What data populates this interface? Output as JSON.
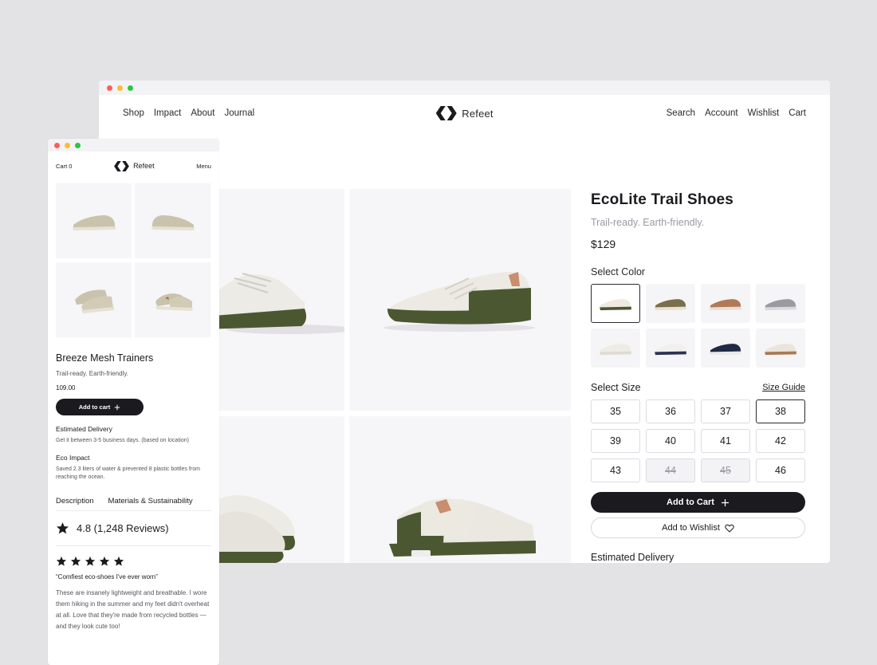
{
  "colors": {
    "red": "#ff5f57",
    "yellow": "#febc2e",
    "green": "#28c840",
    "olive": "#4b5731",
    "primary": "#1b1b1f",
    "muted": "#9a99a3"
  },
  "desktop": {
    "nav_left": [
      "Shop",
      "Impact",
      "About",
      "Journal"
    ],
    "brand": "Refeet",
    "nav_right": [
      "Search",
      "Account",
      "Wishlist",
      "Cart"
    ],
    "product": {
      "title": "EcoLite Trail Shoes",
      "subtitle": "Trail-ready. Earth-friendly.",
      "price": "$129",
      "select_color_label": "Select Color",
      "colors": [
        {
          "upper": "#eeeae2",
          "sole": "#4b5731"
        },
        {
          "upper": "#7a6f4b",
          "sole": "#e8e1d4"
        },
        {
          "upper": "#b07a58",
          "sole": "#e8dfd4"
        },
        {
          "upper": "#9a9ba0",
          "sole": "#dadadd"
        },
        {
          "upper": "#efece6",
          "sole": "#e0dbd2"
        },
        {
          "upper": "#f1f0ee",
          "sole": "#2c3450"
        },
        {
          "upper": "#1f2a44",
          "sole": "#e9e9e9"
        },
        {
          "upper": "#ebe4da",
          "sole": "#a97a52"
        }
      ],
      "select_size_label": "Select Size",
      "size_guide": "Size Guide",
      "sizes": [
        {
          "label": "35",
          "state": "available"
        },
        {
          "label": "36",
          "state": "available"
        },
        {
          "label": "37",
          "state": "available"
        },
        {
          "label": "38",
          "state": "selected"
        },
        {
          "label": "39",
          "state": "available"
        },
        {
          "label": "40",
          "state": "available"
        },
        {
          "label": "41",
          "state": "available"
        },
        {
          "label": "42",
          "state": "available"
        },
        {
          "label": "43",
          "state": "available"
        },
        {
          "label": "44",
          "state": "unavailable"
        },
        {
          "label": "45",
          "state": "unavailable"
        },
        {
          "label": "46",
          "state": "available"
        }
      ],
      "add_to_cart": "Add to Cart",
      "add_to_wishlist": "Add to Wishlist",
      "estimated_delivery": "Estimated Delivery"
    }
  },
  "mobile": {
    "cart": "Cart 0",
    "brand": "Refeet",
    "menu": "Menu",
    "product": {
      "title": "Breeze Mesh Trainers",
      "subtitle": "Trail-ready. Earth-friendly.",
      "price": "109.00",
      "add_to_cart": "Add to cart"
    },
    "delivery": {
      "heading": "Estimated Delivery",
      "text": "Get it between 3-5 business days. (based on location)"
    },
    "eco": {
      "heading": "Eco Impact",
      "text": "Saved 2.3 liters of water & prevented 8 plastic bottles from reaching the ocean."
    },
    "tabs": [
      "Description",
      "Materials & Sustainability"
    ],
    "rating": "4.8 (1,248 Reviews)",
    "review": {
      "stars": 5,
      "quote": "“Comfiest eco-shoes I've ever worn”",
      "text": "These are insanely lightweight and breathable. I wore them hiking in the summer and my feet didn't overheat at all. Love that they're made from recycled bottles — and they look cute too!"
    }
  }
}
